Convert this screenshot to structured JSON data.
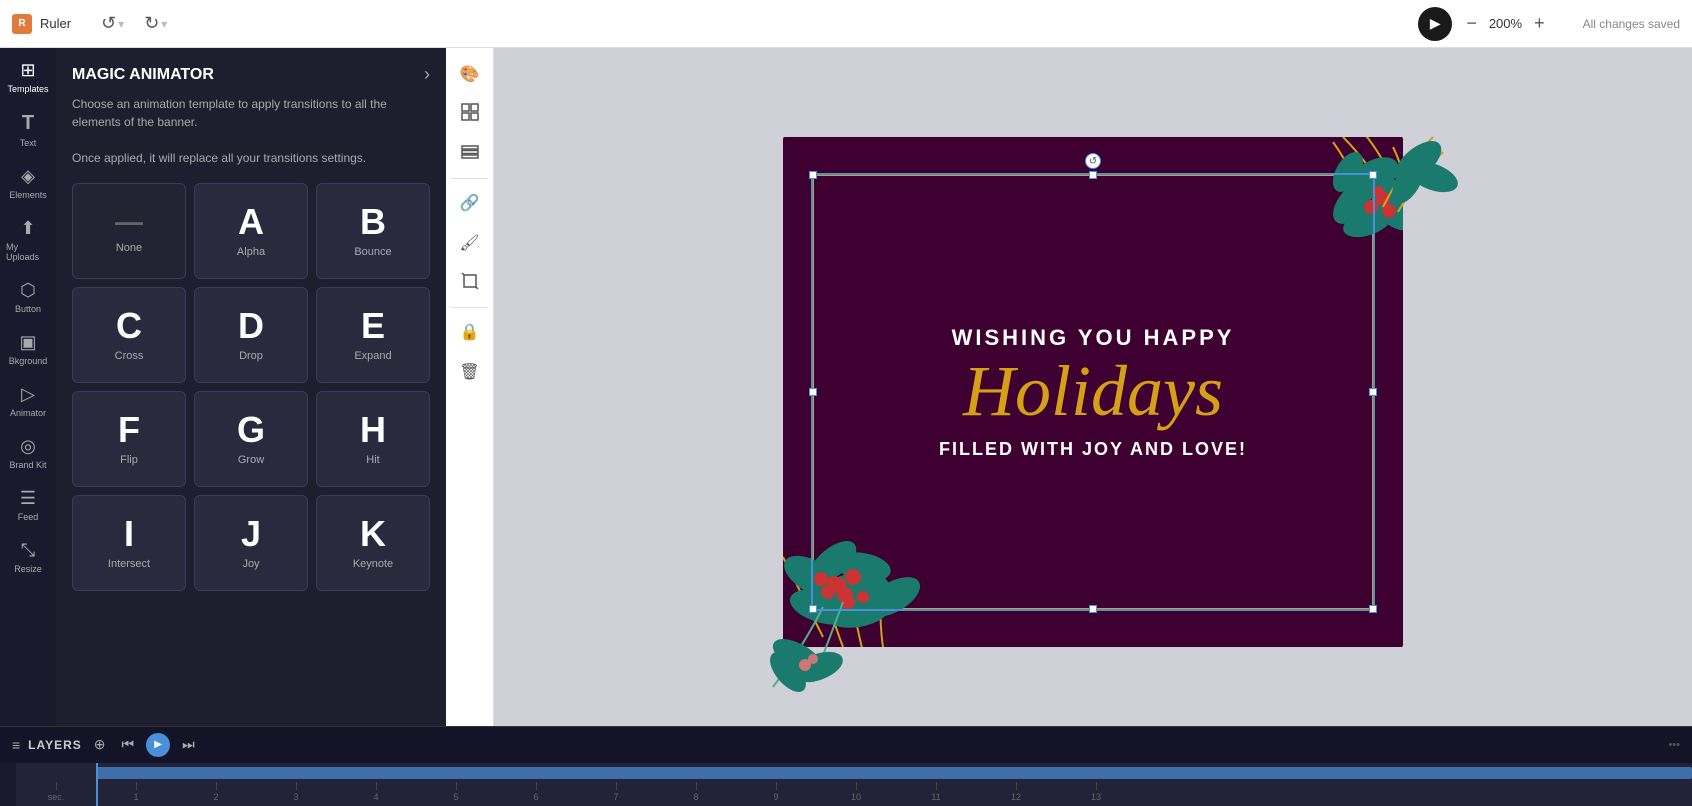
{
  "topbar": {
    "ruler_label": "Ruler",
    "undo_label": "↺",
    "redo_label": "↻",
    "play_label": "▶",
    "zoom_level": "200%",
    "zoom_out_label": "−",
    "zoom_in_label": "+",
    "status_label": "All changes saved"
  },
  "left_nav": {
    "items": [
      {
        "id": "templates",
        "icon": "⊞",
        "label": "Templates"
      },
      {
        "id": "text",
        "icon": "T",
        "label": "Text"
      },
      {
        "id": "elements",
        "icon": "◈",
        "label": "Elements"
      },
      {
        "id": "my-uploads",
        "icon": "↑",
        "label": "My Uploads"
      },
      {
        "id": "button",
        "icon": "⬡",
        "label": "Button"
      },
      {
        "id": "bkground",
        "icon": "▣",
        "label": "Bkground"
      },
      {
        "id": "animator",
        "icon": "▷",
        "label": "Animator"
      },
      {
        "id": "brand-kit",
        "icon": "◎",
        "label": "Brand Kit"
      },
      {
        "id": "feed",
        "icon": "☰",
        "label": "Feed"
      },
      {
        "id": "resize",
        "icon": "⤡",
        "label": "Resize"
      }
    ]
  },
  "anim_panel": {
    "title": "MAGIC ANIMATOR",
    "description": "Choose an animation template to apply transitions to all the elements of the banner.\n\nOnce applied, it will replace all your transitions settings.",
    "close_label": "›",
    "cards": [
      {
        "id": "none",
        "letter": "—",
        "label": "None"
      },
      {
        "id": "alpha",
        "letter": "A",
        "label": "Alpha"
      },
      {
        "id": "bounce",
        "letter": "B",
        "label": "Bounce"
      },
      {
        "id": "cross",
        "letter": "C",
        "label": "Cross"
      },
      {
        "id": "drop",
        "letter": "D",
        "label": "Drop"
      },
      {
        "id": "expand",
        "letter": "E",
        "label": "Expand"
      },
      {
        "id": "flip",
        "letter": "F",
        "label": "Flip"
      },
      {
        "id": "grow",
        "letter": "G",
        "label": "Grow"
      },
      {
        "id": "hit",
        "letter": "H",
        "label": "Hit"
      },
      {
        "id": "intersect",
        "letter": "I",
        "label": "Intersect"
      },
      {
        "id": "joy",
        "letter": "J",
        "label": "Joy"
      },
      {
        "id": "keynote",
        "letter": "K",
        "label": "Keynote"
      }
    ]
  },
  "right_toolbar": {
    "tools": [
      {
        "id": "palette",
        "icon": "🎨"
      },
      {
        "id": "group",
        "icon": "⊞"
      },
      {
        "id": "layers",
        "icon": "≡"
      },
      {
        "id": "link",
        "icon": "🔗"
      },
      {
        "id": "paint",
        "icon": "🖌"
      },
      {
        "id": "crop",
        "icon": "⬚"
      },
      {
        "id": "lock",
        "icon": "🔒"
      },
      {
        "id": "delete",
        "icon": "🗑"
      }
    ]
  },
  "canvas": {
    "card": {
      "line1": "WISHING YOU HAPPY",
      "line2": "Holidays",
      "line3": "FILLED WITH JOY AND LOVE!"
    }
  },
  "timeline": {
    "layers_label": "LAYERS",
    "ruler_marks": [
      "sec.",
      "1",
      "2",
      "3",
      "4",
      "5",
      "6",
      "7",
      "8",
      "9",
      "10",
      "11",
      "12",
      "13"
    ]
  }
}
